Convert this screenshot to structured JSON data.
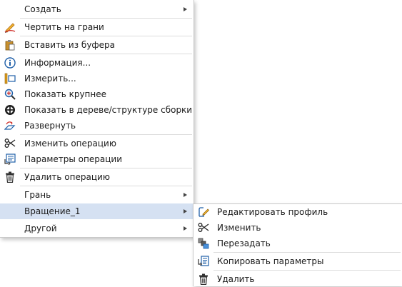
{
  "main_menu": {
    "create": "Создать",
    "draw_on_face": "Чертить на грани",
    "paste": "Вставить из буфера",
    "info": "Информация...",
    "measure": "Измерить...",
    "zoom": "Показать крупнее",
    "show_in_tree": "Показать в дереве/структуре сборки",
    "expand": "Развернуть",
    "edit_operation": "Изменить операцию",
    "operation_params": "Параметры операции",
    "delete_operation": "Удалить операцию",
    "face": "Грань",
    "rotation": "Вращение_1",
    "other": "Другой"
  },
  "sub_menu": {
    "edit_profile": "Редактировать профиль",
    "modify": "Изменить",
    "redefine": "Перезадать",
    "copy_params": "Копировать параметры",
    "delete": "Удалить"
  },
  "icons": [
    "pencil-face-icon",
    "clipboard-paste-icon",
    "info-icon",
    "measure-icon",
    "zoom-in-icon",
    "target-tree-icon",
    "expand-icon",
    "scissors-icon",
    "params-icon",
    "trash-icon",
    "edit-profile-icon",
    "redefine-icon",
    "copy-params-icon"
  ],
  "colors": {
    "highlight": "#d5e1f2",
    "border": "#c9c9c9",
    "separator": "#dcdcdc",
    "accent_blue": "#1f5fa8"
  }
}
